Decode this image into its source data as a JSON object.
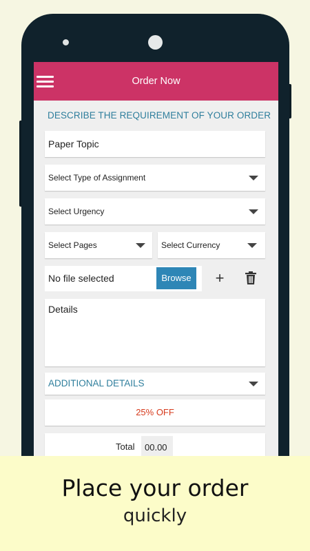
{
  "app": {
    "title": "Order Now"
  },
  "form": {
    "section_title": "DESCRIBE THE REQUIREMENT OF YOUR ORDER",
    "paper_topic_placeholder": "Paper Topic",
    "assignment_type": "Select Type of Assignment",
    "urgency": "Select Urgency",
    "pages": "Select Pages",
    "currency": "Select Currency",
    "file_status": "No file selected",
    "browse_label": "Browse",
    "details_placeholder": "Details",
    "additional_details": "ADDITIONAL DETAILS",
    "discount": "25% OFF",
    "total_label": "Total",
    "total_value": "00.00"
  },
  "icons": {
    "menu": "hamburger-icon",
    "add": "plus-icon",
    "delete": "trash-icon",
    "dropdown": "chevron-down-icon"
  },
  "colors": {
    "app_bar": "#cc3366",
    "section_title": "#2e7e9c",
    "browse_button": "#2e86b6",
    "discount": "#d63a1c",
    "banner": "#fcfcc9"
  },
  "banner": {
    "title": "Place your order",
    "subtitle": "quickly"
  }
}
